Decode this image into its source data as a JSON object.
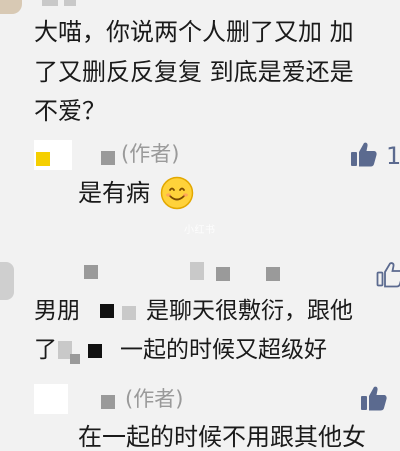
{
  "comments": [
    {
      "text_lines": [
        "大喵，你说两个人删了又加 加",
        "了又删反反复复 到底是爱还是",
        "不爱？"
      ]
    },
    {
      "author_tag": "(作者)",
      "like_count": "1",
      "reply": "是有病",
      "emoji": "smiling-face"
    },
    {
      "text_lines": [
        "男朋",
        "是聊天很敷衍，跟他",
        "了",
        "一起的时候又超级好"
      ]
    },
    {
      "author_tag": "(作者)",
      "reply_partial": "在一起的时候不用跟其他女"
    }
  ],
  "watermark": "小红书",
  "colors": {
    "background": "#f2f2f2",
    "thumb_icon": "#5b6a8f",
    "author_tag": "#9a9a9a"
  }
}
